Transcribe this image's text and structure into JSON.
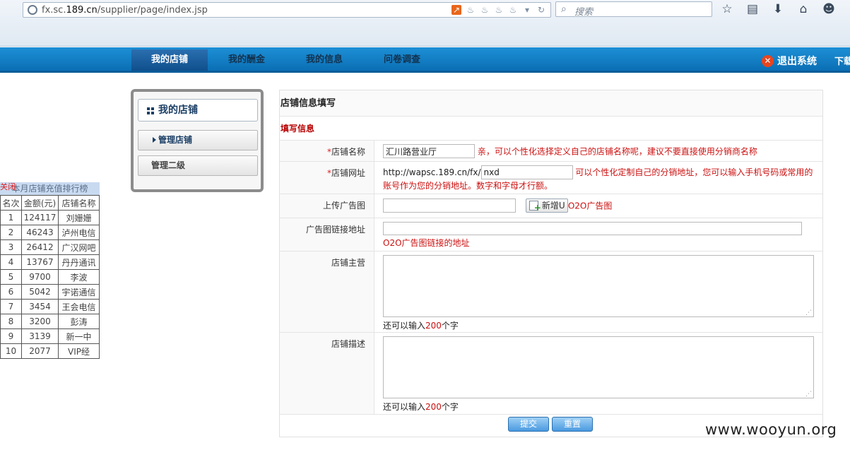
{
  "browser": {
    "url_host": "fx.sc.",
    "url_domain": "189.cn",
    "url_path": "/supplier/page/index.jsp",
    "search_placeholder": "搜索"
  },
  "nav": {
    "tabs": [
      "我的店铺",
      "我的酬金",
      "我的信息",
      "问卷调查"
    ],
    "active_tab": "我的店铺",
    "logout": "退出系统",
    "download": "下载"
  },
  "menu": {
    "title": "我的店铺",
    "items": [
      "管理店铺",
      "管理二级"
    ]
  },
  "ranking": {
    "close": "关闭",
    "title": "本月店铺充值排行榜",
    "headers": [
      "名次",
      "金额(元)",
      "店铺名称"
    ],
    "rows": [
      [
        "1",
        "124117",
        "刘姗姗"
      ],
      [
        "2",
        "46243",
        "泸州电信"
      ],
      [
        "3",
        "26412",
        "广汉网吧"
      ],
      [
        "4",
        "13767",
        "丹丹通讯"
      ],
      [
        "5",
        "9700",
        "李波"
      ],
      [
        "6",
        "5042",
        "宇诺通信"
      ],
      [
        "7",
        "3454",
        "王会电信"
      ],
      [
        "8",
        "3200",
        "彭涛"
      ],
      [
        "9",
        "3139",
        "新一中"
      ],
      [
        "10",
        "2077",
        "VIP经"
      ]
    ]
  },
  "form": {
    "title": "店铺信息填写",
    "subtitle": "填写信息",
    "shop_name_label": "店铺名称",
    "shop_name_value": "汇川路营业厅",
    "shop_name_hint": "亲，可以个性化选择定义自己的店铺名称呢，建议不要直接使用分销商名称",
    "shop_url_label": "店铺网址",
    "shop_url_prefix": "http://wapsc.189.cn/fx/",
    "shop_url_value": "nxd",
    "shop_url_hint_1": "可以个性化定制自己的分销地址，您可以输入手机号码或常用的",
    "shop_url_hint_2": "账号作为您的分销地址。数字和字母才行额。",
    "ad_upload_label": "上传广告图",
    "ad_upload_button": "新增U",
    "ad_upload_hint": "O2O广告图",
    "ad_link_label": "广告图链接地址",
    "ad_link_hint": "O2O广告图链接的地址",
    "main_business_label": "店铺主营",
    "description_label": "店铺描述",
    "counter_prefix": "还可以输入",
    "counter_value": "200",
    "counter_suffix": "个字",
    "submit": "提交",
    "reset": "重置"
  },
  "watermark": "www.wooyun.org"
}
